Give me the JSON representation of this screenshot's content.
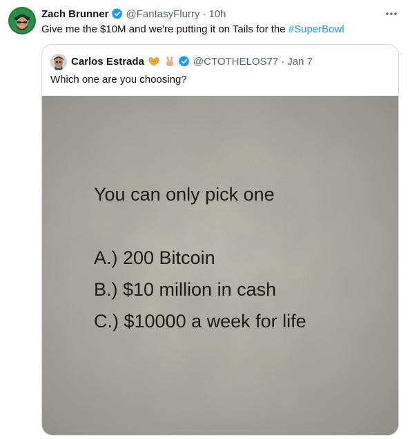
{
  "tweet": {
    "author_name": "Zach Brunner",
    "author_handle": "@FantasyFlurry",
    "separator": "·",
    "time": "10h",
    "text_before": "Give me the $10M and we're putting it on Tails for the ",
    "hashtag": "#SuperBowl"
  },
  "quote": {
    "author_name": "Carlos Estrada",
    "author_handle": "@CTOTHELOS77",
    "separator": "·",
    "date": "Jan 7",
    "text": "Which one are you choosing?",
    "media": {
      "title": "You can only pick one",
      "options": [
        "A.) 200 Bitcoin",
        "B.) $10 million in cash",
        "C.) $10000 a week for life"
      ]
    }
  },
  "icons": {
    "verified": "verified-badge-icon",
    "more": "more-options-icon",
    "emoji_heart_hands": "heart-hands-emoji",
    "emoji_victory": "victory-hand-emoji"
  },
  "colors": {
    "link": "#1d9bf0",
    "secondary_text": "#536471",
    "verified": "#1d9bf0",
    "border": "#cfd9de"
  }
}
